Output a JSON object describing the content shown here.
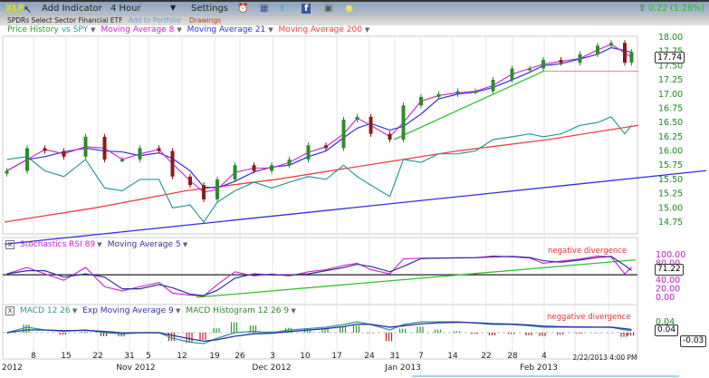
{
  "toolbar": {
    "symbol": "XLF",
    "add_indicator": "Add Indicator",
    "interval": "4 Hour",
    "settings": "Settings",
    "change": "0.22 (1.26%)",
    "icons": [
      "alarm-clock-icon",
      "book-icon",
      "twitter-icon",
      "facebook-icon",
      "camera-icon",
      "comment-icon"
    ]
  },
  "subtitle": {
    "name": "SPDRs Select Sector Financial ETF",
    "add_portfolio": "Add to Portfolio",
    "drawings": "Drawings"
  },
  "legend": {
    "price": "Price History",
    "vs": "vs SPY",
    "ma8": "Moving Average 8",
    "ma21": "Moving Average 21",
    "ma200": "Moving Average 200"
  },
  "colors": {
    "up": "#2e8b2e",
    "down": "#8b1a1a",
    "ma8": "#d020d0",
    "ma21": "#3030e0",
    "ma200": "#f04040",
    "spy": "#2a9a9a",
    "trend_green": "#30c030",
    "trend_blue": "#3030e0"
  },
  "x_axis": {
    "days": [
      "8",
      "15",
      "22",
      "31",
      "5",
      "12",
      "19",
      "26",
      "3",
      "10",
      "17",
      "24",
      "31",
      "7",
      "14",
      "22",
      "28",
      "4"
    ],
    "months": [
      "2012",
      "Nov 2012",
      "Dec 2012",
      "Jan 2013",
      "Feb 2013"
    ],
    "timestamp": "2/22/2013 4:00 PM"
  },
  "chart_data": [
    {
      "type": "line",
      "panel": "price",
      "ylim": [
        14.75,
        18.0
      ],
      "yticks": [
        "18.00",
        "17.75",
        "17.50",
        "17.25",
        "17.00",
        "16.75",
        "16.50",
        "16.25",
        "16.00",
        "15.75",
        "15.50",
        "15.25",
        "15.00",
        "14.75"
      ],
      "last_value": "17.74",
      "close": [
        15.65,
        16.05,
        16.0,
        15.9,
        16.25,
        15.85,
        15.85,
        16.05,
        16.0,
        15.55,
        15.4,
        15.15,
        15.5,
        15.75,
        15.65,
        15.75,
        15.85,
        16.1,
        16.05,
        16.55,
        16.6,
        16.3,
        16.2,
        16.8,
        16.95,
        17.0,
        17.05,
        17.05,
        17.25,
        17.45,
        17.45,
        17.6,
        17.55,
        17.7,
        17.85,
        17.9,
        17.55,
        17.74
      ],
      "spy_relative": [
        15.85,
        15.9,
        15.65,
        15.55,
        15.85,
        15.35,
        15.3,
        15.5,
        15.5,
        15.0,
        15.05,
        14.75,
        15.1,
        15.3,
        15.45,
        15.35,
        15.45,
        15.55,
        15.5,
        15.75,
        15.55,
        15.4,
        15.2,
        15.85,
        15.8,
        15.95,
        15.95,
        16.0,
        16.2,
        16.25,
        16.3,
        16.25,
        16.3,
        16.45,
        16.5,
        16.6,
        16.3,
        16.45
      ],
      "ma200": [
        14.75,
        15.0,
        15.3,
        15.5,
        15.75,
        16.0,
        16.2,
        16.45
      ],
      "trendlines": [
        {
          "color": "blue",
          "from": 14.6,
          "to": 15.75
        },
        {
          "color": "green",
          "from": 16.2,
          "to": 17.4
        },
        {
          "color": "red",
          "from": 17.4,
          "to": 17.4
        }
      ]
    },
    {
      "type": "line",
      "panel": "stochastics",
      "title": "Stochastics RSI 89",
      "ma_label": "Moving Average 5",
      "annotation": "negative divergence",
      "ylim": [
        0,
        100
      ],
      "yticks": [
        "100.00",
        "80.00",
        "60.00",
        "40.00",
        "20.00",
        "0.00"
      ],
      "last_value": "71.22",
      "reference_level": 53,
      "values": [
        55,
        70,
        55,
        40,
        70,
        25,
        15,
        25,
        35,
        10,
        5,
        3,
        30,
        60,
        50,
        55,
        50,
        60,
        65,
        75,
        80,
        65,
        55,
        90,
        92,
        92,
        93,
        93,
        97,
        95,
        92,
        80,
        85,
        90,
        97,
        95,
        55,
        71
      ],
      "trendline": {
        "from": 0,
        "to": 88
      }
    },
    {
      "type": "bar",
      "panel": "macd",
      "title": "MACD 12 26",
      "signal_label": "Exp Moving Average 9",
      "hist_label": "MACD Histogram 12 26 9",
      "annotation": "neggative divergence",
      "yticks": [
        "0.04",
        "0.00"
      ],
      "last_macd": "0.04",
      "last_hist": "-0.03",
      "macd": [
        0.0,
        0.02,
        0.01,
        0.005,
        0.01,
        0.0,
        -0.005,
        0.0,
        0.0,
        -0.02,
        -0.035,
        -0.04,
        -0.02,
        0.0,
        0.005,
        0.0,
        0.01,
        0.015,
        0.02,
        0.03,
        0.04,
        0.03,
        0.01,
        0.03,
        0.04,
        0.04,
        0.04,
        0.035,
        0.03,
        0.03,
        0.025,
        0.02,
        0.02,
        0.02,
        0.02,
        0.02,
        0.01,
        0.008
      ]
    }
  ]
}
